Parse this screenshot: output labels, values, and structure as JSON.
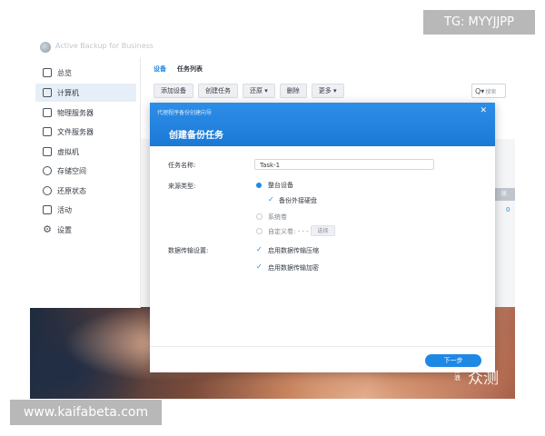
{
  "watermarks": {
    "top": "TG: MYYJJPP",
    "bottom": "www.kaifabeta.com",
    "logo": "众测",
    "logo_small": "新浪"
  },
  "app": {
    "title": "Active Backup for Business"
  },
  "sidebar": {
    "items": [
      {
        "label": "总览",
        "icon": "overview-icon"
      },
      {
        "label": "计算机",
        "icon": "computer-icon",
        "active": true
      },
      {
        "label": "物理服务器",
        "icon": "server-icon"
      },
      {
        "label": "文件服务器",
        "icon": "file-server-icon"
      },
      {
        "label": "虚拟机",
        "icon": "vm-icon"
      },
      {
        "label": "存储空间",
        "icon": "storage-icon"
      },
      {
        "label": "还原状态",
        "icon": "restore-icon"
      },
      {
        "label": "活动",
        "icon": "activity-icon"
      },
      {
        "label": "设置",
        "icon": "gear-icon"
      }
    ]
  },
  "tabs": {
    "device": "设备",
    "task_list": "任务列表"
  },
  "toolbar": {
    "add_device": "添加设备",
    "create_task": "创建任务",
    "restore": "还原 ▾",
    "delete": "删除",
    "more": "更多 ▾"
  },
  "search": {
    "placeholder": "搜索"
  },
  "grid": {
    "header_fragment": "版",
    "link_fragment": "0"
  },
  "dialog": {
    "subtitle": "代理程序备份创建向导",
    "title": "创建备份任务",
    "task_name_label": "任务名称:",
    "task_name_value": "Task-1",
    "source_type_label": "来源类型:",
    "source_options": {
      "whole_device": "整台设备",
      "include_external": "备份外接硬盘",
      "system_volume": "系统卷",
      "custom_volume": "自定义卷: - - -",
      "select_button": "选择"
    },
    "transfer_label": "数据传输设置:",
    "transfer_options": {
      "compression": "启用数据传输压缩",
      "encryption": "启用数据传输加密"
    },
    "next_button": "下一步"
  },
  "colors": {
    "accent": "#1e88e5",
    "header_blue": "#2d8ee8"
  }
}
